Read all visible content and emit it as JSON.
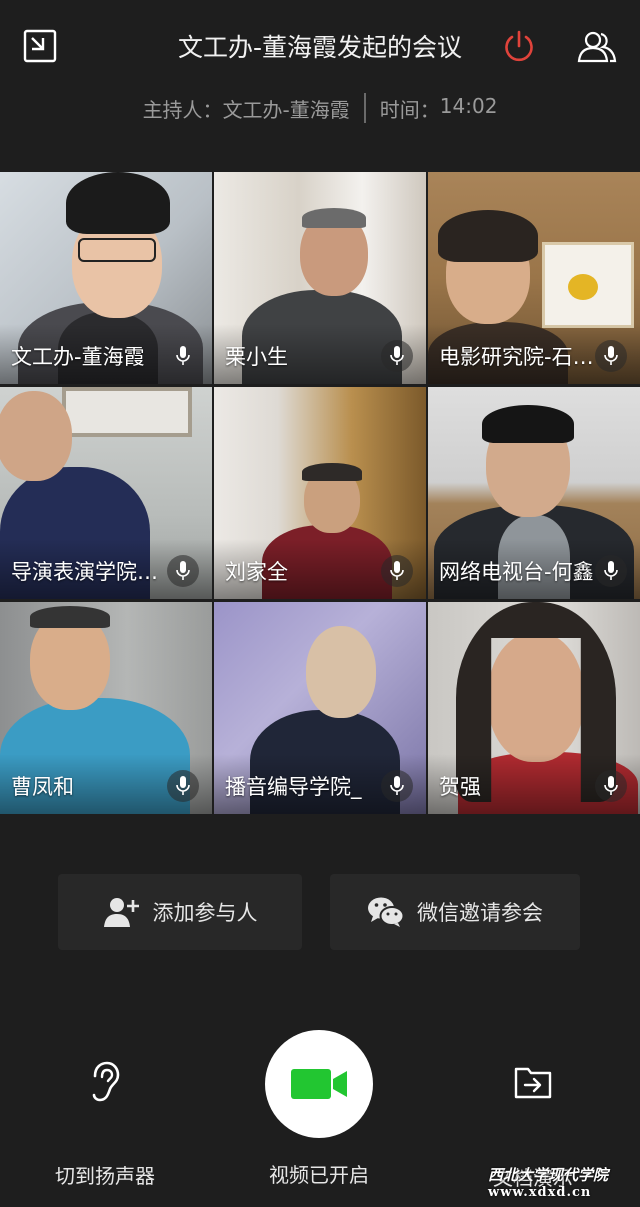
{
  "header": {
    "title": "文工办-董海霞发起的会议",
    "host_label": "主持人：",
    "host_name": "文工办-董海霞",
    "time_label": "时间：",
    "time_value": "14:02"
  },
  "colors": {
    "background": "#1e1e1e",
    "end_call": "#e0433b",
    "video_on": "#22c631",
    "muted_text": "#9a9a9a"
  },
  "participants": [
    {
      "name": "文工办-董海霞"
    },
    {
      "name": "栗小生"
    },
    {
      "name": "电影研究院-石…"
    },
    {
      "name": "导演表演学院…"
    },
    {
      "name": "刘家全"
    },
    {
      "name": "网络电视台-何鑫"
    },
    {
      "name": "曹凤和"
    },
    {
      "name": "播音编导学院_"
    },
    {
      "name": "贺强"
    }
  ],
  "actions": {
    "add_participant": "添加参与人",
    "wechat_invite": "微信邀请参会"
  },
  "controls": {
    "speaker": "切到扬声器",
    "video": "视频已开启",
    "doc": "文档演示"
  },
  "watermark": {
    "text": "西北大学现代学院",
    "url": "www.xdxd.cn"
  },
  "icons": {
    "minimize": "minimize-window-icon",
    "end": "power-icon",
    "members": "members-icon",
    "mic": "microphone-icon",
    "add_user": "add-user-icon",
    "wechat": "wechat-icon",
    "ear": "ear-icon",
    "camera": "video-camera-icon",
    "share": "folder-share-icon"
  }
}
